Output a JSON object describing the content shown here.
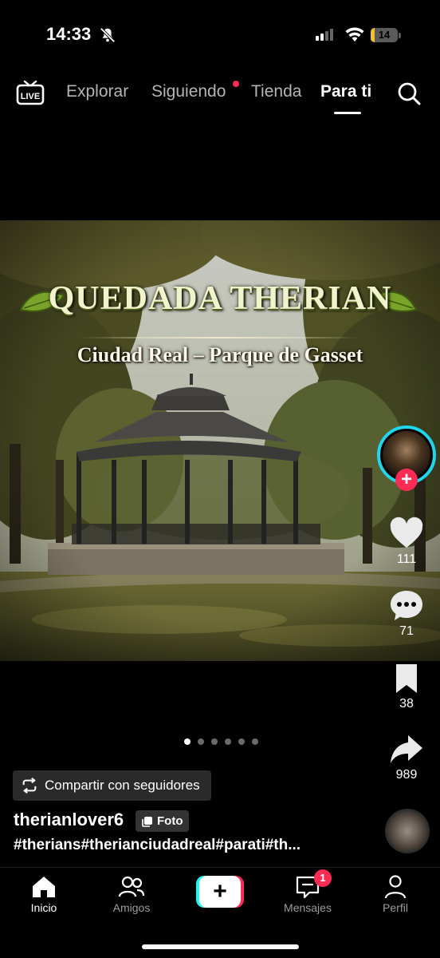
{
  "status_bar": {
    "time": "14:33",
    "battery": "14",
    "battery_level": 0.14
  },
  "top_nav": {
    "live_label": "LIVE",
    "tabs": [
      "Explorar",
      "Siguiendo",
      "Tienda",
      "Para ti"
    ],
    "active_tab": "Para ti"
  },
  "post": {
    "title": "QUEDADA THERIAN",
    "subtitle": "Ciudad Real – Parque de Gasset",
    "slide_count": 6,
    "active_slide": 1
  },
  "rail": {
    "likes": "111",
    "comments": "71",
    "saves": "38",
    "shares": "989"
  },
  "share_chip": {
    "label": "Compartir con seguidores"
  },
  "author": {
    "username": "therianlover6",
    "badge": "Foto"
  },
  "caption": {
    "hashtags": "#therians#therianciudadreal#parati#th..."
  },
  "bottom_nav": {
    "items": [
      "Inicio",
      "Amigos",
      "Mensajes",
      "Perfil"
    ],
    "create_symbol": "+",
    "messages_badge": "1"
  },
  "colors": {
    "accent": "#fe2c55",
    "cyan": "#25f4ee",
    "battery": "#f2c230"
  },
  "icons": [
    "bell-slash-icon",
    "signal-icon",
    "wifi-icon",
    "live-tv-icon",
    "search-icon",
    "heart-icon",
    "comment-icon",
    "bookmark-icon",
    "share-icon",
    "repost-icon",
    "photo-icon",
    "home-icon",
    "friends-icon",
    "inbox-icon",
    "profile-icon"
  ]
}
